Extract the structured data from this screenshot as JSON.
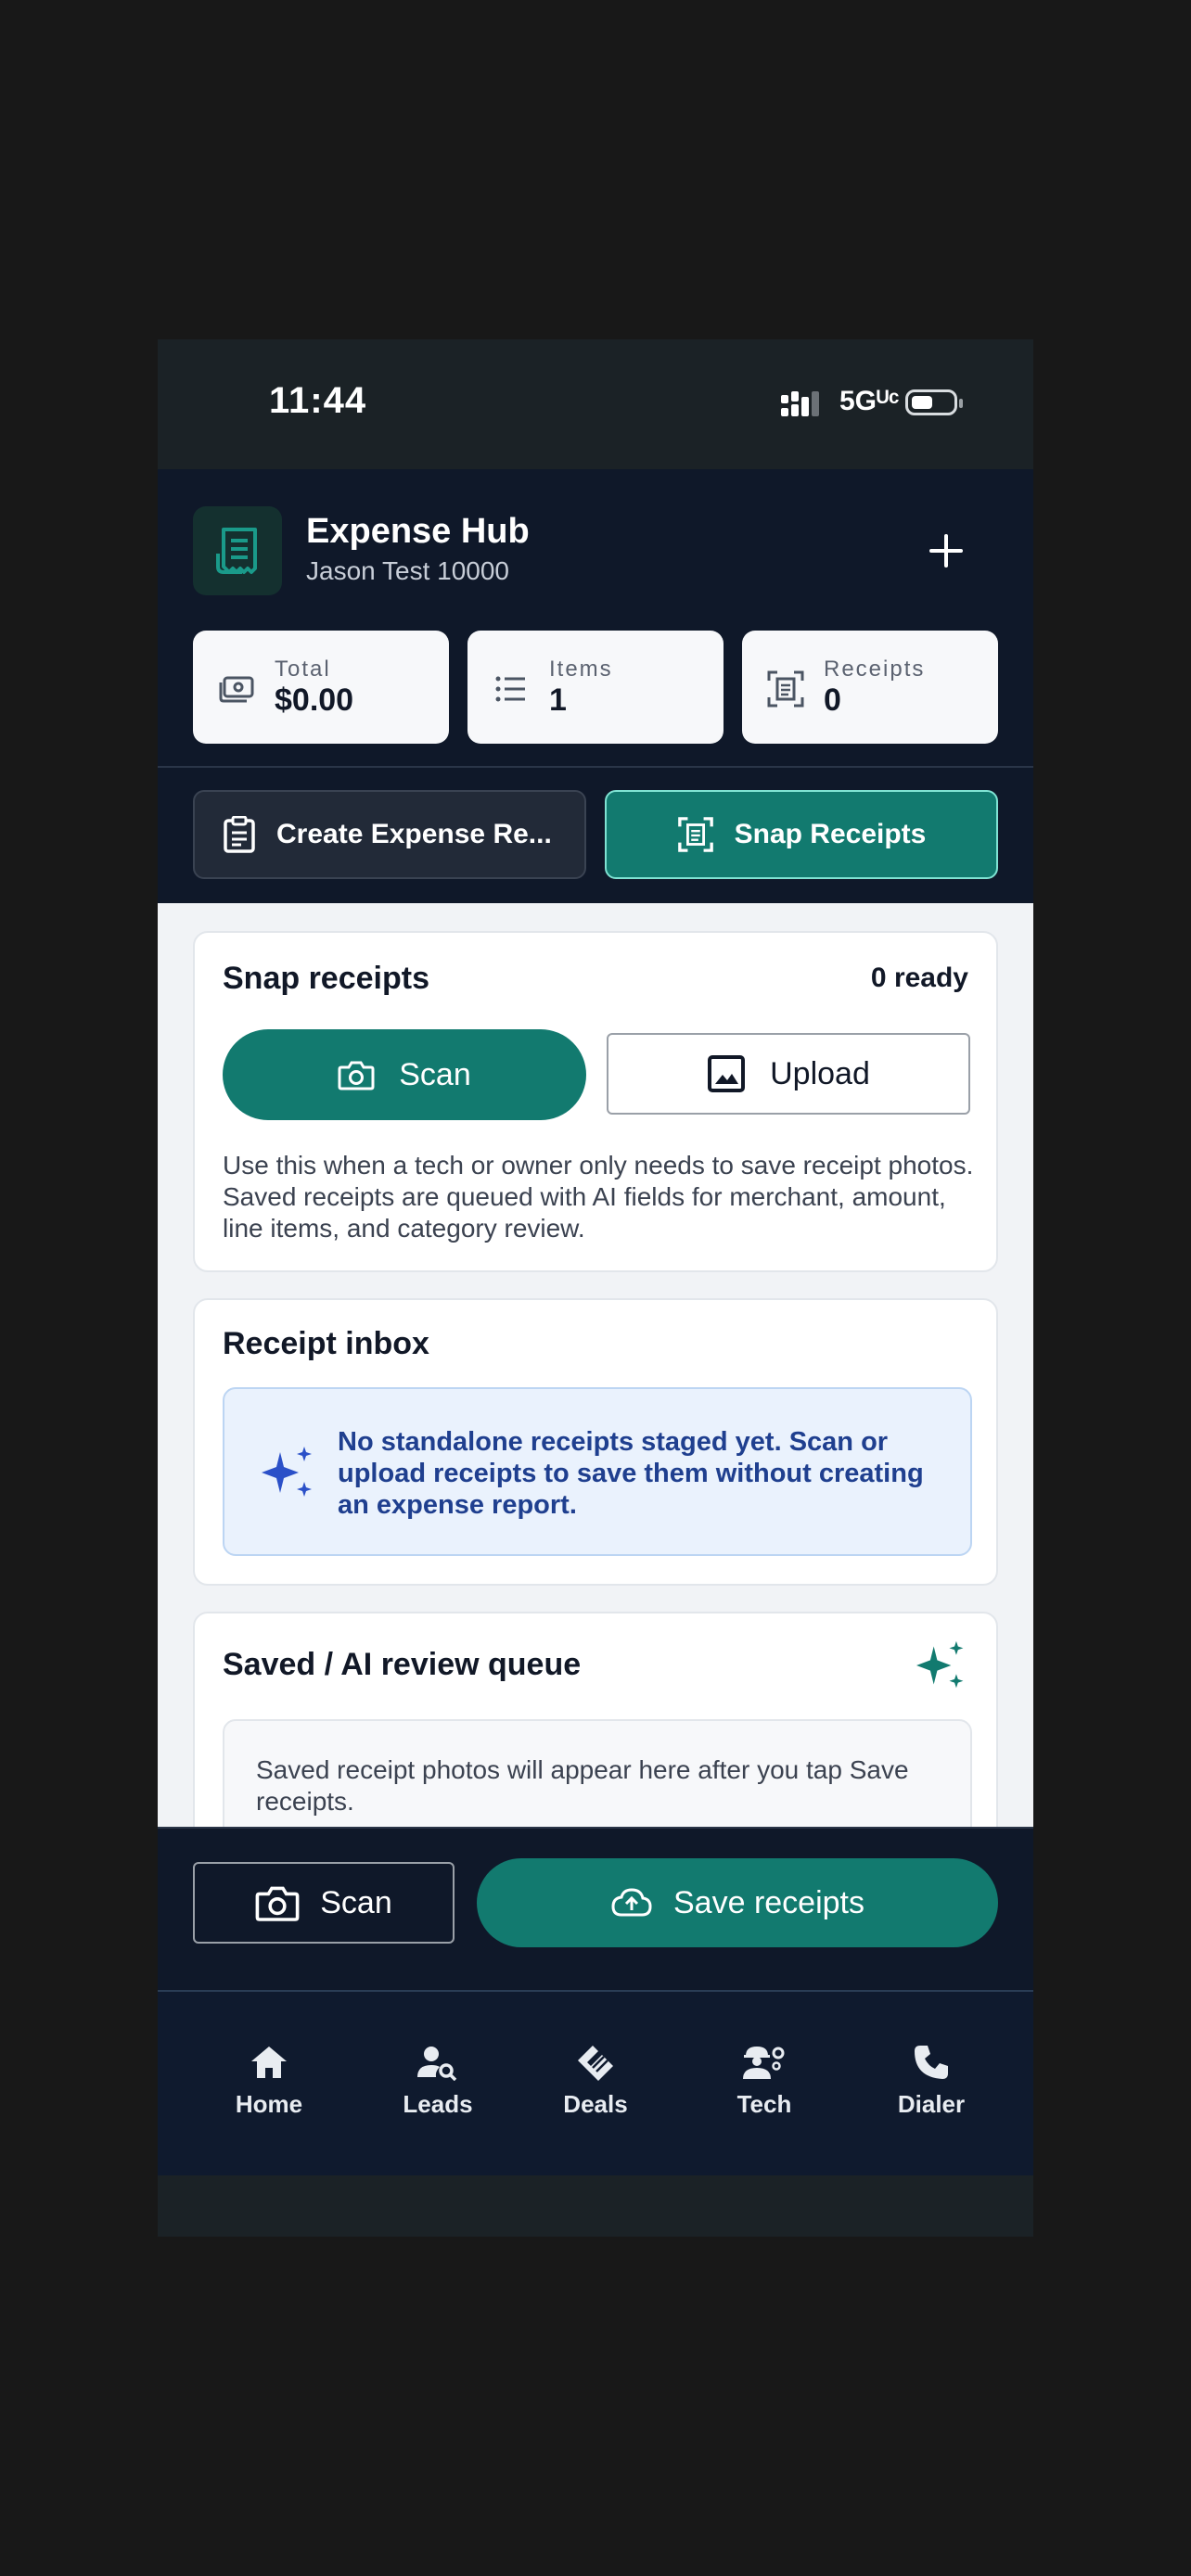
{
  "status_bar": {
    "time": "11:44",
    "network": "5Gᵁᶜ"
  },
  "header": {
    "title": "Expense Hub",
    "subtitle": "Jason Test 10000"
  },
  "stats": [
    {
      "label": "Total",
      "value": "$0.00"
    },
    {
      "label": "Items",
      "value": "1"
    },
    {
      "label": "Receipts",
      "value": "0"
    }
  ],
  "actions": {
    "create_label": "Create Expense Re...",
    "snap_label": "Snap Receipts"
  },
  "snap_card": {
    "title": "Snap receipts",
    "ready": "0 ready",
    "scan_label": "Scan",
    "upload_label": "Upload",
    "description": "Use this when a tech or owner only needs to save receipt photos. Saved receipts are queued with AI fields for merchant, amount, line items, and category review."
  },
  "inbox_card": {
    "title": "Receipt inbox",
    "note": "No standalone receipts staged yet. Scan or upload receipts to save them without creating an expense report."
  },
  "queue_card": {
    "title": "Saved / AI review queue",
    "note": "Saved receipt photos will appear here after you tap Save receipts."
  },
  "bottom_bar": {
    "scan_label": "Scan",
    "save_label": "Save receipts"
  },
  "nav": [
    {
      "label": "Home",
      "icon": "home-icon"
    },
    {
      "label": "Leads",
      "icon": "person-search-icon"
    },
    {
      "label": "Deals",
      "icon": "handshake-icon"
    },
    {
      "label": "Tech",
      "icon": "engineer-icon"
    },
    {
      "label": "Dialer",
      "icon": "phone-icon"
    }
  ],
  "colors": {
    "accent": "#127a6f",
    "navy": "#0f1829",
    "note_blue": "#1f3f8f"
  }
}
